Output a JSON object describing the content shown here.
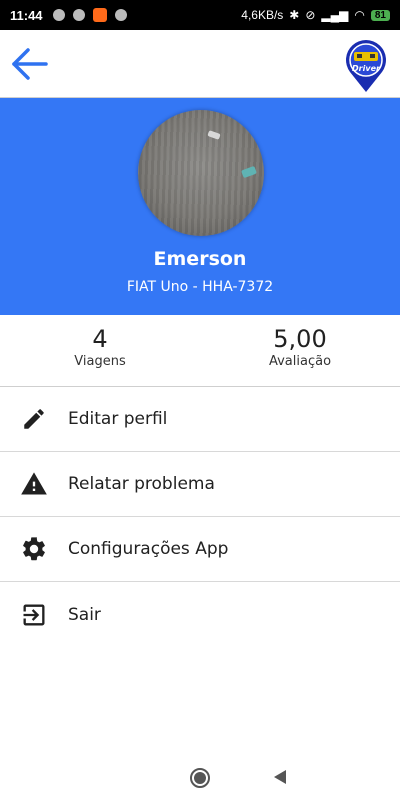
{
  "status_bar": {
    "time": "11:44",
    "network_speed": "4,6KB/s",
    "battery": "81"
  },
  "app_bar": {
    "back_icon": "arrow-left-icon",
    "logo_text": "Driver"
  },
  "profile": {
    "name": "Emerson",
    "vehicle": "FIAT Uno - HHA-7372"
  },
  "stats": {
    "trips": {
      "value": "4",
      "label": "Viagens"
    },
    "rating": {
      "value": "5,00",
      "label": "Avaliação"
    }
  },
  "menu": {
    "items": [
      {
        "label": "Editar perfil",
        "icon": "pencil-icon"
      },
      {
        "label": "Relatar problema",
        "icon": "warning-icon"
      },
      {
        "label": "Configurações App",
        "icon": "gear-icon"
      },
      {
        "label": "Sair",
        "icon": "logout-icon"
      }
    ]
  },
  "colors": {
    "primary": "#3477f5",
    "back_arrow": "#2f72f0"
  }
}
